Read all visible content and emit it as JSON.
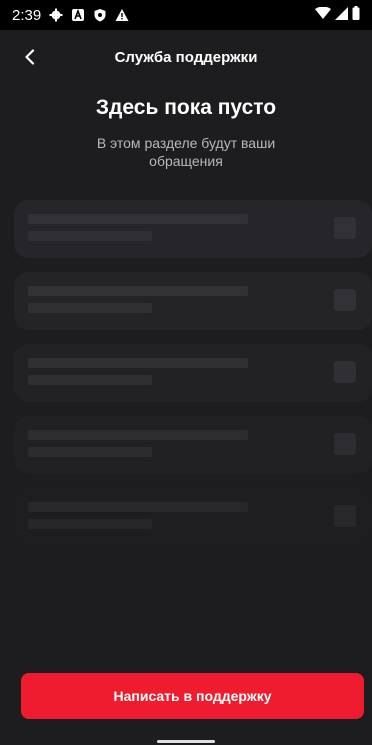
{
  "status_bar": {
    "time": "2:39",
    "left_icons": [
      "gear-icon",
      "notification-a-icon",
      "shield-icon",
      "warning-icon"
    ],
    "right_icons": [
      "wifi-icon",
      "signal-icon",
      "battery-icon"
    ]
  },
  "header": {
    "title": "Служба поддержки",
    "back_icon": "chevron-left-icon"
  },
  "empty_state": {
    "title": "Здесь пока пусто",
    "subtitle": "В этом разделе будут ваши обращения"
  },
  "cta": {
    "label": "Написать в поддержку"
  },
  "colors": {
    "background": "#1d1d1f",
    "accent": "#ee1c2e",
    "status_bar": "#000000"
  }
}
